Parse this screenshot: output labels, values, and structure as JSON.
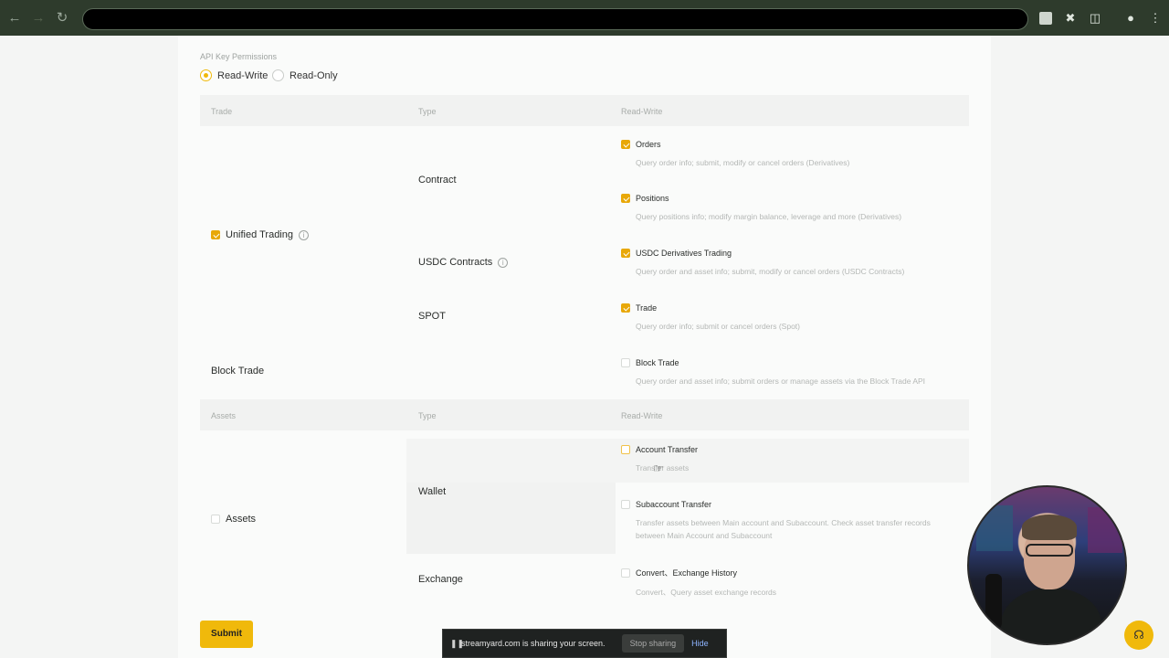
{
  "browser": {
    "icons": [
      "back-icon",
      "forward-icon",
      "reload-icon",
      "extension-icon",
      "puzzle-icon",
      "profile-icon",
      "menu-icon"
    ]
  },
  "permissions": {
    "title": "API Key Permissions",
    "radio_read_write": "Read-Write",
    "radio_read_only": "Read-Only",
    "selected": "Read-Write"
  },
  "trade_table": {
    "col1": "Trade",
    "col2": "Type",
    "col3": "Read-Write",
    "unified_trading": "Unified Trading",
    "contract": "Contract",
    "usdc_contracts": "USDC Contracts",
    "spot": "SPOT",
    "block_trade": "Block Trade",
    "perms": [
      {
        "label": "Orders",
        "desc": "Query order info; submit, modify or cancel orders (Derivatives)",
        "checked": true
      },
      {
        "label": "Positions",
        "desc": "Query positions info; modify margin balance, leverage and more (Derivatives)",
        "checked": true
      },
      {
        "label": "USDC Derivatives Trading",
        "desc": "Query order and asset info; submit, modify or cancel orders (USDC Contracts)",
        "checked": true
      },
      {
        "label": "Trade",
        "desc": "Query order info; submit or cancel orders (Spot)",
        "checked": true
      },
      {
        "label": "Block Trade",
        "desc": "Query order and asset info; submit orders or manage assets via the Block Trade API",
        "checked": false
      }
    ]
  },
  "assets_table": {
    "col1": "Assets",
    "col2": "Type",
    "col3": "Read-Write",
    "assets": "Assets",
    "wallet": "Wallet",
    "exchange": "Exchange",
    "perms": [
      {
        "label": "Account Transfer",
        "desc": "Transfer assets",
        "checked": false
      },
      {
        "label": "Subaccount Transfer",
        "desc": "Transfer assets between Main account and Subaccount. Check asset transfer records between Main Account and Subaccount",
        "checked": false
      },
      {
        "label": "Convert、Exchange History",
        "desc": "Convert、Query asset exchange records",
        "checked": false
      }
    ]
  },
  "submit_label": "Submit",
  "share_bar": {
    "message": "streamyard.com is sharing your screen.",
    "stop": "Stop sharing",
    "hide": "Hide"
  },
  "colors": {
    "accent": "#f0b90b",
    "checkbox": "#e8a808",
    "chrome": "#2e3b2c"
  }
}
